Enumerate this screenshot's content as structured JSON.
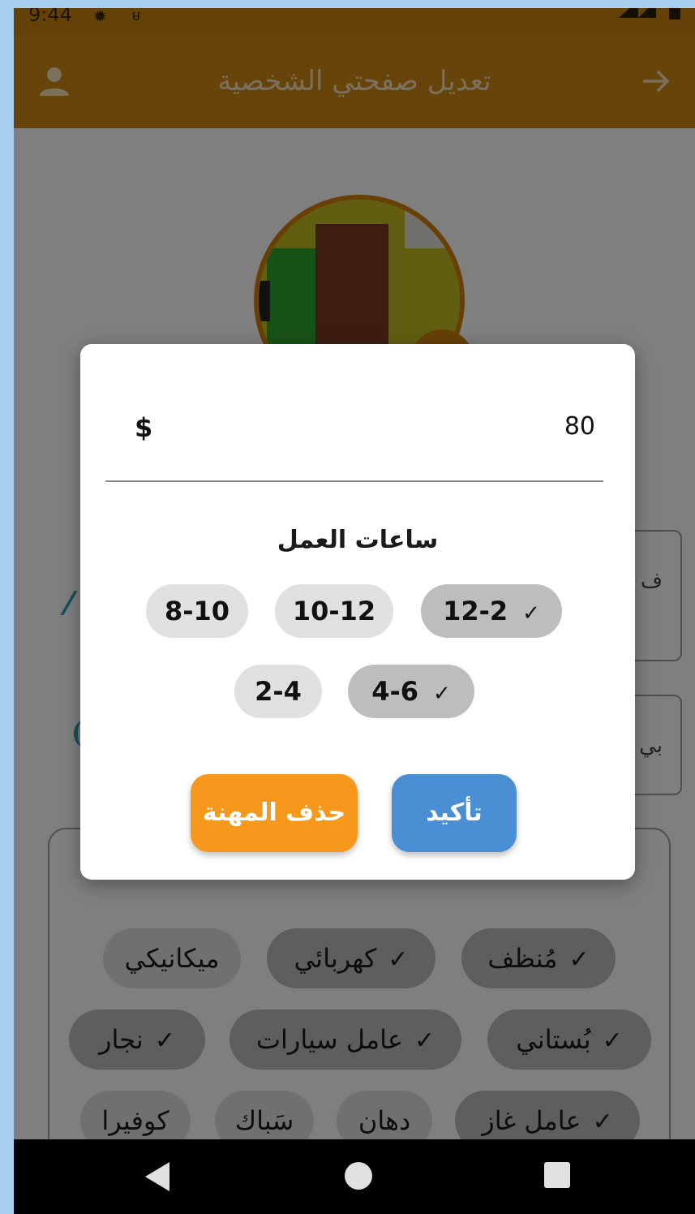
{
  "status_bar": {
    "time": "9:44"
  },
  "app_bar": {
    "title": "تعديل صفحتي الشخصية"
  },
  "background": {
    "card_1_text": "ف",
    "card_2_text": "بي",
    "profession_chips": [
      {
        "label": "مُنظف",
        "selected": true
      },
      {
        "label": "كهربائي",
        "selected": true
      },
      {
        "label": "ميكانيكي",
        "selected": false
      },
      {
        "label": "بُستاني",
        "selected": true
      },
      {
        "label": "عامل سيارات",
        "selected": true
      },
      {
        "label": "نجار",
        "selected": true
      },
      {
        "label": "عامل غاز",
        "selected": true
      },
      {
        "label": "دهان",
        "selected": false
      },
      {
        "label": "سَباك",
        "selected": false
      },
      {
        "label": "كوفيرا",
        "selected": false
      }
    ]
  },
  "dialog": {
    "currency": "$",
    "price": "80",
    "hours_title": "ساعات العمل",
    "hour_chips": [
      {
        "label": "12-2",
        "selected": true
      },
      {
        "label": "10-12",
        "selected": false
      },
      {
        "label": "8-10",
        "selected": false
      },
      {
        "label": "4-6",
        "selected": true
      },
      {
        "label": "2-4",
        "selected": false
      }
    ],
    "confirm_label": "تأكيد",
    "delete_label": "حذف المهنة"
  },
  "colors": {
    "app_bar": "#cf8812",
    "confirm": "#4a8fd4",
    "delete": "#f6981b",
    "chip_selected": "#bdbdbd",
    "chip_default": "#e0e0e0"
  },
  "icons": {
    "check": "✓",
    "settings": "✹",
    "app": "ᵾ"
  }
}
